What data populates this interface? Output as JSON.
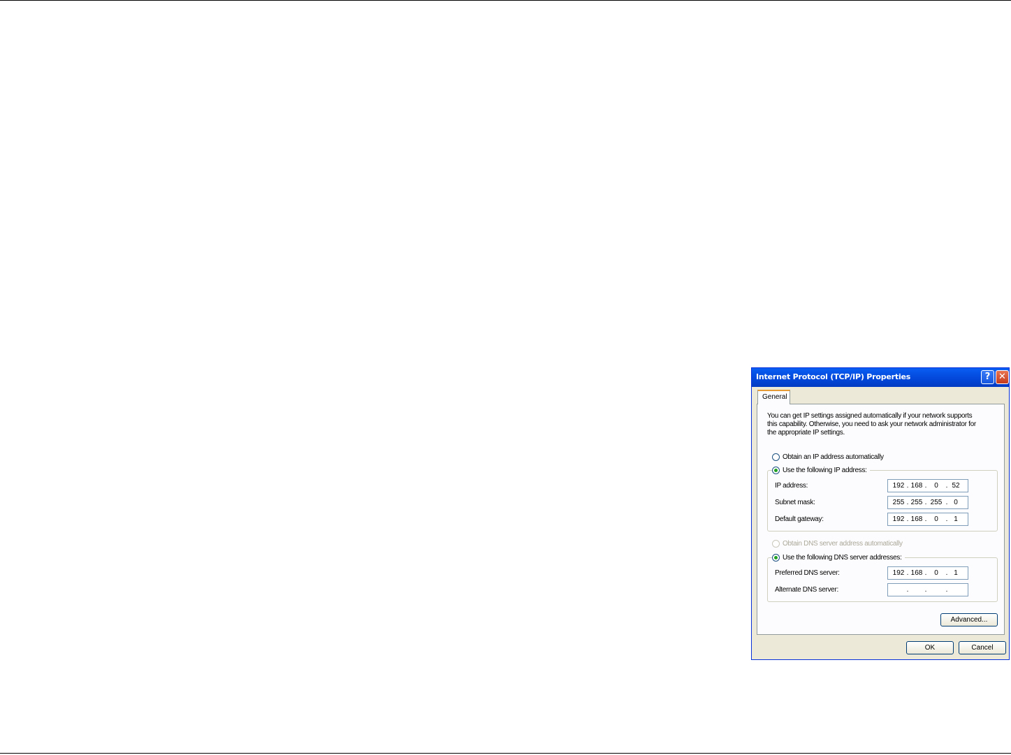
{
  "dialog": {
    "title": "Internet Protocol (TCP/IP) Properties",
    "help_glyph": "?",
    "close_glyph": "✕",
    "tab_label": "General",
    "description": [
      "You can get IP settings assigned automatically if your network supports",
      "this capability. Otherwise, you need to ask your network administrator for",
      "the appropriate IP settings."
    ],
    "ip_auto_label": "Obtain an IP address automatically",
    "ip_manual_label": "Use the following IP address:",
    "ip_mode_selected": "manual",
    "ip_address_label": "IP address:",
    "ip_address": [
      "192",
      "168",
      "0",
      "52"
    ],
    "subnet_label": "Subnet mask:",
    "subnet": [
      "255",
      "255",
      "255",
      "0"
    ],
    "gateway_label": "Default gateway:",
    "gateway": [
      "192",
      "168",
      "0",
      "1"
    ],
    "dns_auto_label": "Obtain DNS server address automatically",
    "dns_auto_disabled": true,
    "dns_manual_label": "Use the following DNS server addresses:",
    "dns_mode_selected": "manual",
    "preferred_dns_label": "Preferred DNS server:",
    "preferred_dns": [
      "192",
      "168",
      "0",
      "1"
    ],
    "alternate_dns_label": "Alternate DNS server:",
    "alternate_dns": [
      "",
      "",
      "",
      ""
    ],
    "advanced_label": "Advanced...",
    "ok_label": "OK",
    "cancel_label": "Cancel"
  },
  "colors": {
    "titlebar": "#0246d8",
    "dialog_bg": "#ece9d8",
    "tab_accent": "#e69b34",
    "radio_dot": "#21a121"
  }
}
